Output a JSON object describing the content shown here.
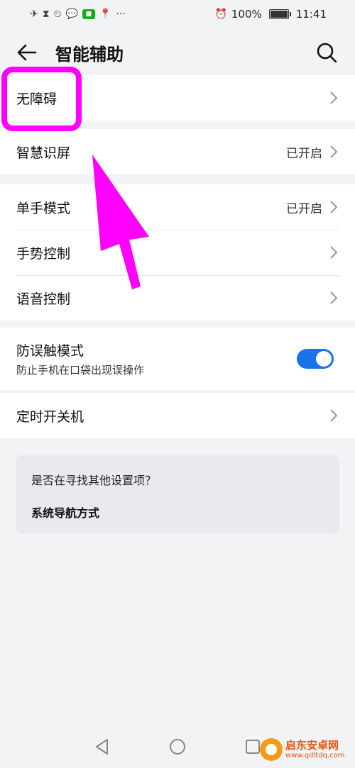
{
  "status_bar": {
    "alarm_glyph": "⏰",
    "battery": "100%",
    "time": "11:41",
    "more": "···"
  },
  "header": {
    "title": "智能辅助"
  },
  "sections": {
    "accessibility": {
      "label": "无障碍"
    },
    "smart_screen": {
      "label": "智慧识屏",
      "value": "已开启"
    },
    "one_hand": {
      "label": "单手模式",
      "value": "已开启"
    },
    "gesture": {
      "label": "手势控制"
    },
    "voice": {
      "label": "语音控制"
    },
    "pocket_mode": {
      "title": "防误触模式",
      "subtitle": "防止手机在口袋出现误操作",
      "enabled": true
    },
    "timer_power": {
      "label": "定时开关机"
    }
  },
  "suggestion": {
    "question": "是否在寻找其他设置项？",
    "link": "系统导航方式"
  },
  "watermark": {
    "name": "启东安卓网",
    "url": "www.qdltdq.com"
  },
  "colors": {
    "highlight": "#ff00ff",
    "toggle_on": "#1a73e8",
    "watermark": "#e8540c"
  }
}
